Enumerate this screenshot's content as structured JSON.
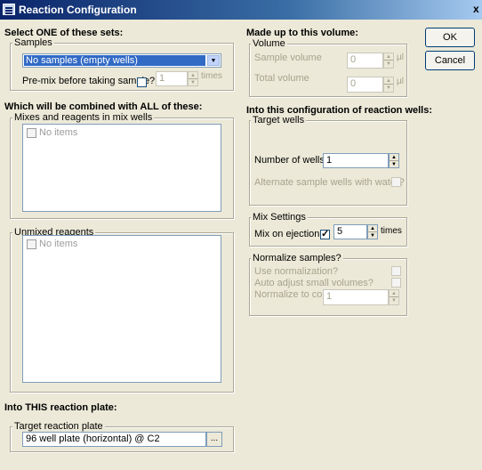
{
  "window": {
    "title": "Reaction Configuration",
    "close_glyph": "x"
  },
  "left": {
    "select_heading": "Select ONE of these sets:",
    "samples_group": "Samples",
    "samples_value": "No samples (empty wells)",
    "premix_label": "Pre-mix before taking sample?",
    "premix_times_value": "1",
    "premix_times_unit": "times",
    "combine_heading": "Which will be combined with ALL of these:",
    "mixes_group": "Mixes and reagents in mix wells",
    "mixes_items": [
      "No items"
    ],
    "unmixed_group": "Unmixed reagents",
    "unmixed_items": [
      "No items"
    ],
    "plate_heading": "Into THIS reaction plate:",
    "plate_group": "Target reaction plate",
    "plate_value": "96 well plate (horizontal) @ C2",
    "browse_label": "..."
  },
  "right": {
    "volume_heading": "Made up to this volume:",
    "volume_group": "Volume",
    "sample_volume_label": "Sample volume",
    "sample_volume_value": "0",
    "total_volume_label": "Total volume",
    "total_volume_value": "0",
    "unit_ul": "µl",
    "config_heading": "Into this configuration of reaction wells:",
    "target_group": "Target wells",
    "num_wells_label": "Number of wells",
    "num_wells_value": "1",
    "alternate_label": "Alternate sample wells with water?",
    "mix_group": "Mix Settings",
    "mix_label": "Mix on ejection?",
    "mix_checked": true,
    "mix_times_value": "5",
    "mix_times_unit": "times",
    "normalize_group": "Normalize samples?",
    "use_norm_label": "Use normalization?",
    "auto_adjust_label": "Auto adjust small volumes?",
    "norm_conc_label": "Normalize to conc:",
    "norm_conc_value": "1"
  },
  "buttons": {
    "ok": "OK",
    "cancel": "Cancel"
  },
  "icons": {
    "checkmark": "✓",
    "spin_up": "▲",
    "spin_down": "▼",
    "dropdown": "▼"
  }
}
